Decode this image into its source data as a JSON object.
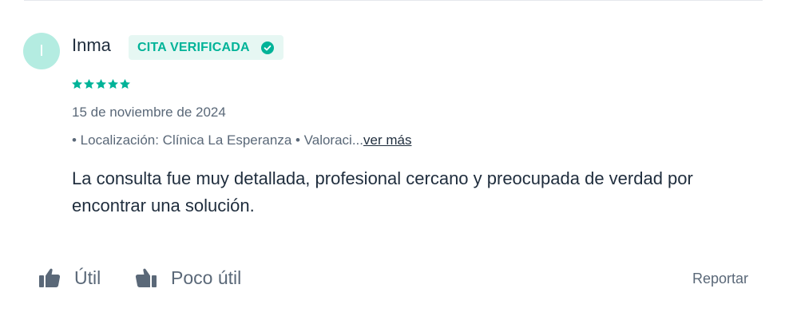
{
  "review": {
    "avatar_initial": "I",
    "author": "Inma",
    "badge_label": "CITA VERIFICADA",
    "rating": 5,
    "rating_max": 5,
    "date": "15 de noviembre de 2024",
    "meta_text": "• Localización: Clínica La Esperanza • Valoraci...",
    "more_link": "ver más",
    "text": "La consulta fue muy detallada, profesional cercano y preocupada de verdad por encontrar una solución."
  },
  "actions": {
    "useful_label": "Útil",
    "not_useful_label": "Poco útil",
    "report_label": "Reportar"
  },
  "icons": {
    "badge": "check-circle-icon",
    "star": "star-icon",
    "useful": "thumbs-up-icon",
    "not_useful": "thumbs-down-icon"
  },
  "colors": {
    "accent": "#00b398",
    "badge_bg": "#e6f7f3",
    "avatar_bg": "#b4ece1",
    "text": "#1f2d3d",
    "muted": "#5a6878"
  }
}
